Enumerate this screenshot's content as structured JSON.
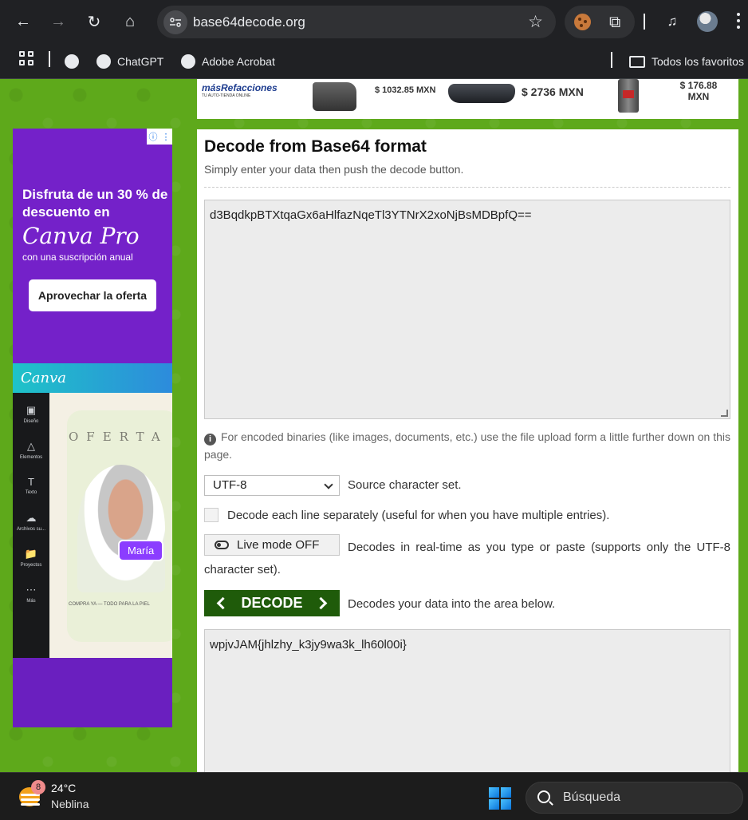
{
  "browser": {
    "url": "base64decode.org",
    "bookmarks": [
      "ChatGPT",
      "Adobe Acrobat"
    ],
    "all_bookmarks_label": "Todos los favoritos"
  },
  "banner_ad": {
    "brand": "másRefacciones",
    "brand_tagline": "TU AUTO-TIENDA ONLINE",
    "prices": [
      "$ 1032.85 MXN",
      "$ 2736 MXN",
      "$ 176.88 MXN"
    ]
  },
  "side_ad": {
    "headline": "Disfruta de un 30 % de descuento en",
    "product": "Canva Pro",
    "subline": "con una suscripción anual",
    "cta": "Aprovechar la oferta",
    "strip_brand": "Canva",
    "sidebar": [
      "Diseño",
      "Elementos",
      "Texto",
      "Archivos su...",
      "Proyectos",
      "Más"
    ],
    "oferta": "OFERTA",
    "name_tag": "María",
    "buy_text": "COMPRA YA — TODO PARA LA PIEL"
  },
  "decoder": {
    "title": "Decode from Base64 format",
    "subtitle": "Simply enter your data then push the decode button.",
    "input_value": "d3BqdkpBTXtqaGx6aHlfazNqeTl3YTNrX2xoNjBsMDBpfQ==",
    "info": "For encoded binaries (like images, documents, etc.) use the file upload form a little further down on this page.",
    "charset_value": "UTF-8",
    "charset_label": "Source character set.",
    "checkbox_label": "Decode each line separately (useful for when you have multiple entries).",
    "live_mode_label": "Live mode OFF",
    "live_mode_desc": "Decodes in real-time as you type or paste (supports only the UTF-8 character set).",
    "decode_label": "DECODE",
    "decode_desc": "Decodes your data into the area below.",
    "output_value": "wpjvJAM{jhlzhy_k3jy9wa3k_lh60l00i}"
  },
  "taskbar": {
    "notification_count": "8",
    "temperature": "24°C",
    "condition": "Neblina",
    "search_placeholder": "Búsqueda"
  }
}
